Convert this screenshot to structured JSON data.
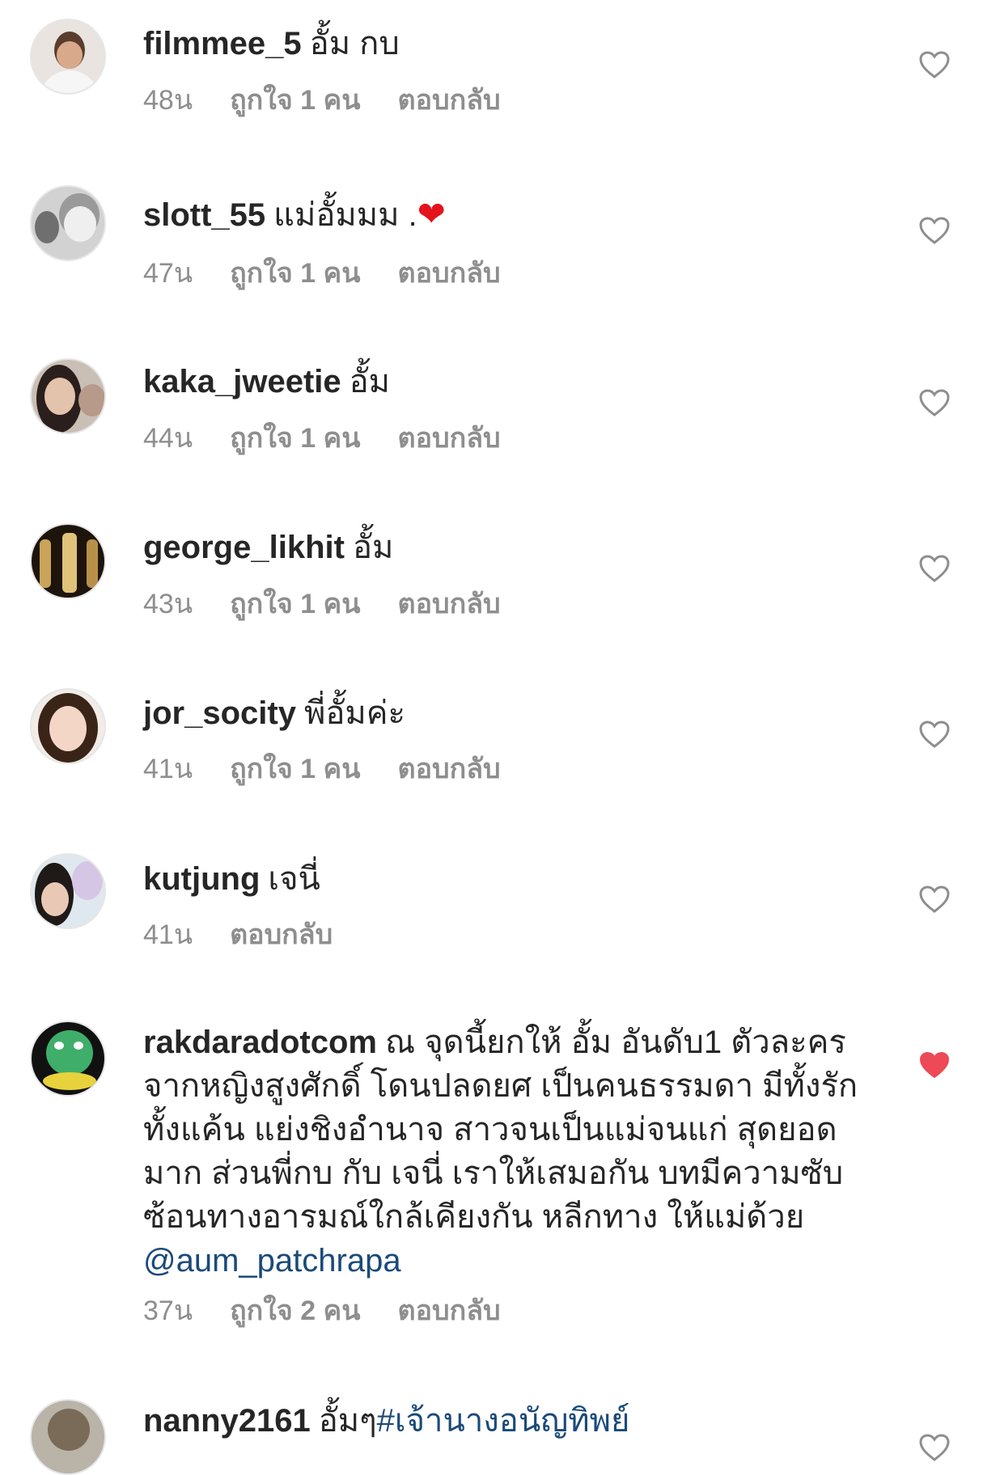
{
  "comments": [
    {
      "username": "filmmee_5",
      "text": "อั้ม กบ",
      "time": "48น",
      "likes": "ถูกใจ 1 คน",
      "reply": "ตอบกลับ",
      "liked": false
    },
    {
      "username": "slott_55",
      "text": "แม่อั้มมม .",
      "emoji": "❤",
      "time": "47น",
      "likes": "ถูกใจ 1 คน",
      "reply": "ตอบกลับ",
      "liked": false
    },
    {
      "username": "kaka_jweetie",
      "text": "อั้ม",
      "time": "44น",
      "likes": "ถูกใจ 1 คน",
      "reply": "ตอบกลับ",
      "liked": false
    },
    {
      "username": "george_likhit",
      "text": "อั้ม",
      "time": "43น",
      "likes": "ถูกใจ 1 คน",
      "reply": "ตอบกลับ",
      "liked": false
    },
    {
      "username": "jor_socity",
      "text": "พี่อั้มค่ะ",
      "time": "41น",
      "likes": "ถูกใจ 1 คน",
      "reply": "ตอบกลับ",
      "liked": false
    },
    {
      "username": "kutjung",
      "text": "เจนี่",
      "time": "41น",
      "reply": "ตอบกลับ",
      "liked": false
    },
    {
      "username": "rakdaradotcom",
      "lines": [
        "ณ จุดนี้ยกให้ อั้ม อันดับ1 ตัวละคร",
        "จากหญิงสูงศักดิ์ โดนปลดยศ เป็นคนธรรมดา มีทั้งรัก",
        "ทั้งแค้น แย่งชิงอำนาจ สาวจนเป็นแม่จนแก่ สุดยอด",
        "มาก ส่วนพี่กบ กับ เจนี่ เราให้เสมอกัน บทมีความซับ",
        "ซ้อนทางอารมณ์ใกล้เคียงกัน หลีกทาง ให้แม่ด้วย"
      ],
      "mention": "@aum_patchrapa",
      "time": "37น",
      "likes": "ถูกใจ 2 คน",
      "reply": "ตอบกลับ",
      "liked": true
    },
    {
      "username": "nanny2161",
      "text": "อั้มๆ",
      "hashtag": "#เจ้านางอนัญทิพย์",
      "liked": false
    }
  ],
  "colors": {
    "text": "#262626",
    "meta": "#8e8e8e",
    "link": "#1a4a7a",
    "liked": "#ed4956"
  },
  "icons": {
    "like": "heart-outline-icon",
    "liked": "heart-filled-icon"
  }
}
